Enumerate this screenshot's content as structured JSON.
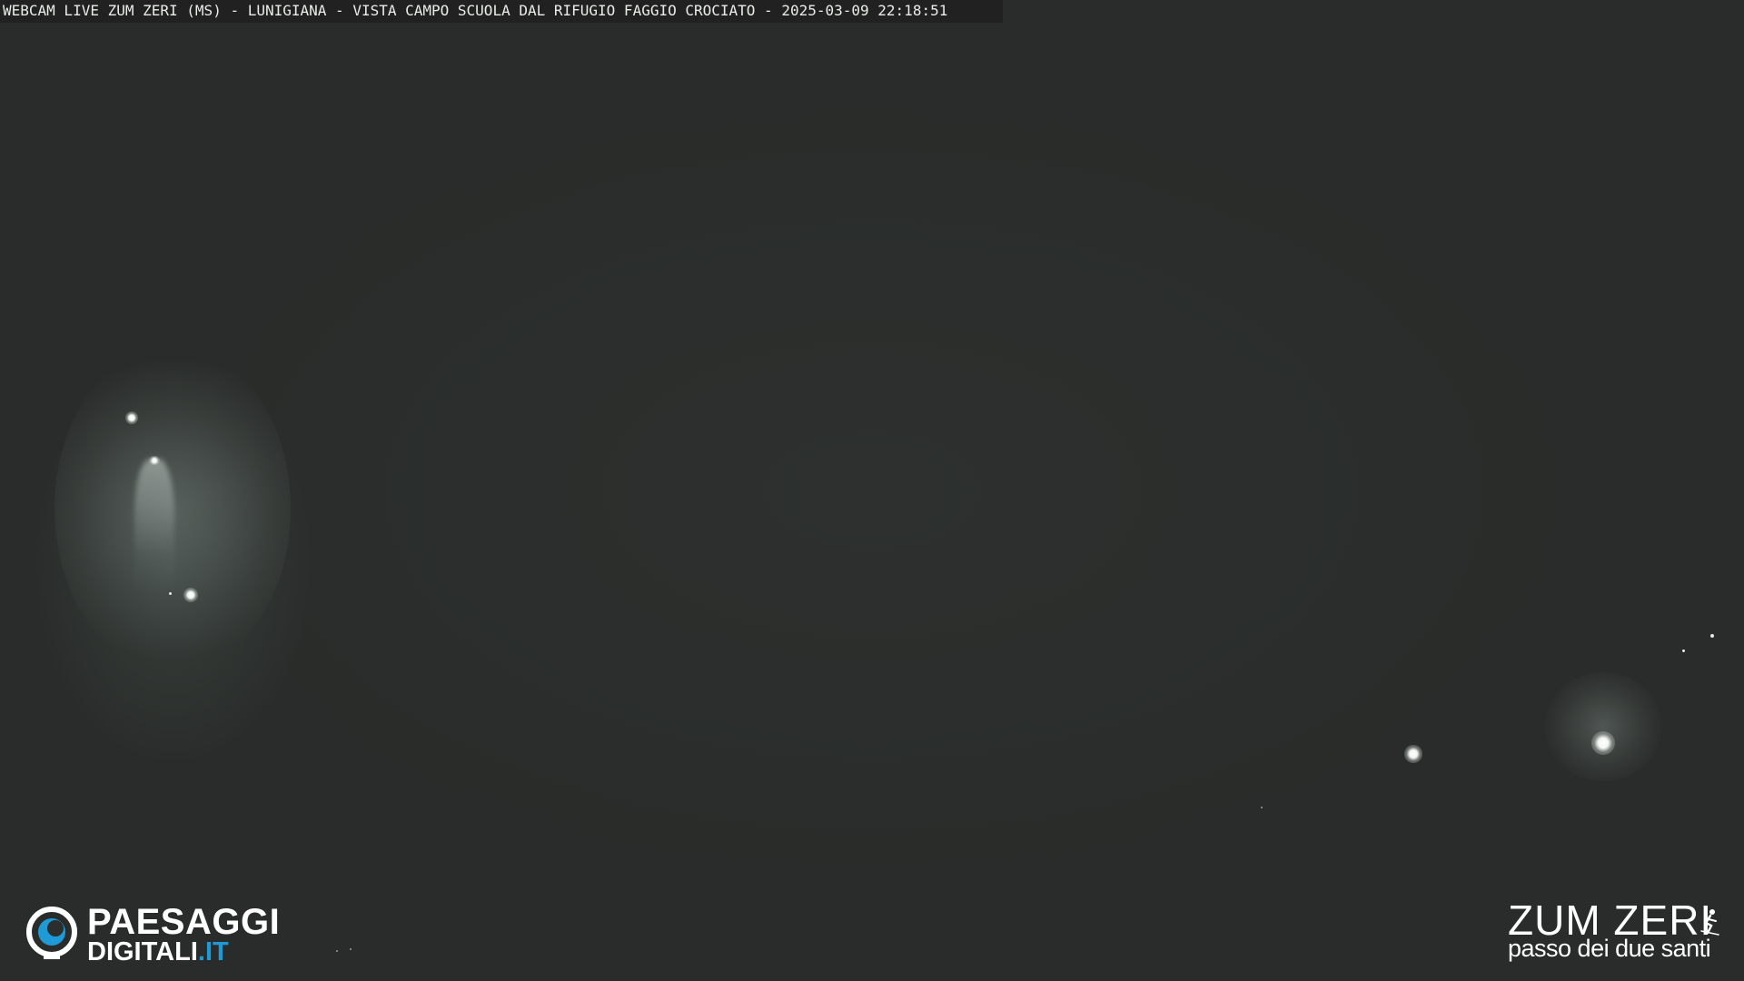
{
  "overlay": {
    "caption": "WEBCAM LIVE ZUM ZERI (MS) - LUNIGIANA - VISTA CAMPO SCUOLA DAL RIFUGIO FAGGIO CROCIATO - 2025-03-09 22:18:51"
  },
  "logo_left": {
    "line1": "PAESAGGI",
    "line2_main": "DIGITALI",
    "line2_accent": ".IT",
    "accent_color": "#1e9ad6",
    "icon": "eye-icon"
  },
  "logo_right": {
    "title": "ZUM ZERI",
    "subtitle": "passo dei due santi",
    "icon": "skier-icon"
  },
  "colors": {
    "background": "#2b2e2c",
    "text": "#ffffff"
  }
}
